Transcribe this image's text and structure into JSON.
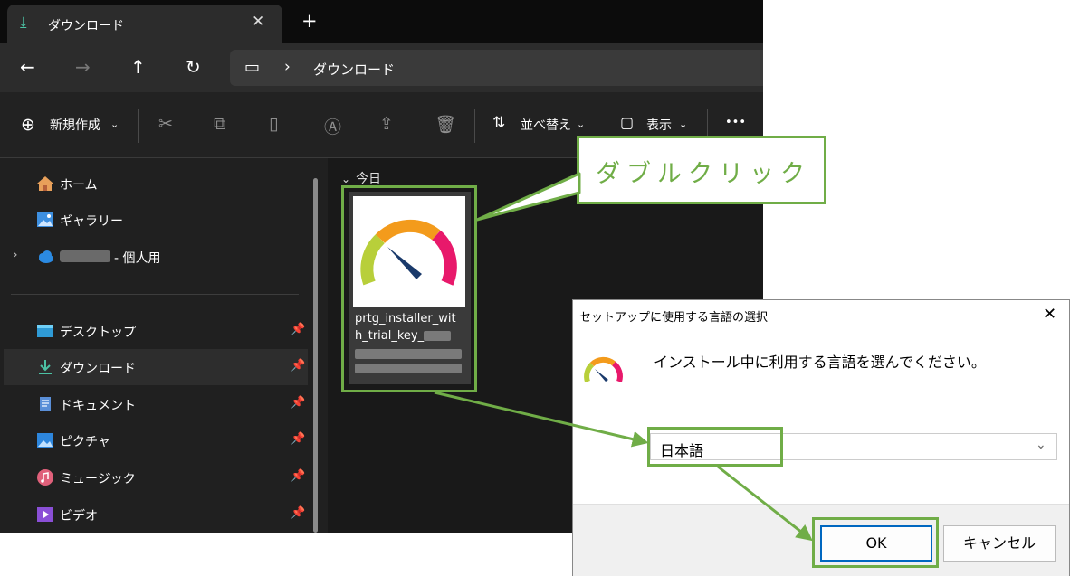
{
  "explorer": {
    "tab_title": "ダウンロード",
    "new_tab": "+",
    "breadcrumb": "ダウンロード",
    "commands": {
      "new": "新規作成",
      "sort": "並べ替え",
      "view": "表示",
      "more": "•••"
    },
    "sidebar": {
      "home": "ホーム",
      "gallery": "ギャラリー",
      "onedrive_suffix": "- 個人用",
      "desktop": "デスクトップ",
      "downloads": "ダウンロード",
      "documents": "ドキュメント",
      "pictures": "ピクチャ",
      "music": "ミュージック",
      "videos": "ビデオ"
    },
    "group_label": "今日",
    "file": {
      "name_line1": "prtg_installer_wit",
      "name_line2": "h_trial_key_"
    }
  },
  "callout": {
    "text": "ダブルクリック"
  },
  "dialog": {
    "title": "セットアップに使用する言語の選択",
    "close": "✕",
    "message": "インストール中に利用する言語を選んでください。",
    "selected_language": "日本語",
    "ok_label": "OK",
    "cancel_label": "キャンセル"
  },
  "colors": {
    "annotation": "#70ad47",
    "accent": "#0067c0",
    "download_icon": "#4cc2a4"
  }
}
